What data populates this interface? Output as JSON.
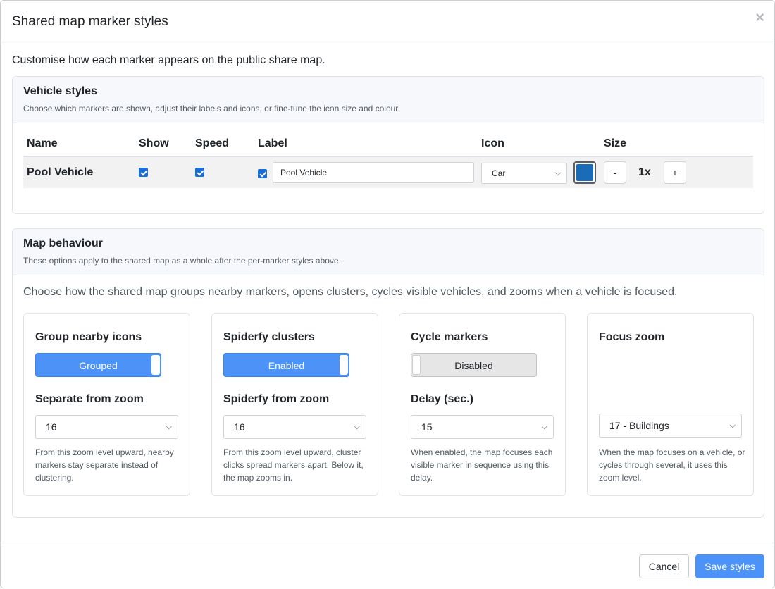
{
  "modal": {
    "title": "Shared map marker styles",
    "close_glyph": "×",
    "intro": "Customise how each marker appears on the public share map."
  },
  "vehicle_styles": {
    "title": "Vehicle styles",
    "subtitle": "Choose which markers are shown, adjust their labels and icons, or fine-tune the icon size and colour.",
    "columns": {
      "name": "Name",
      "show": "Show",
      "speed": "Speed",
      "label": "Label",
      "icon": "Icon",
      "size": "Size"
    },
    "rows": [
      {
        "name": "Pool Vehicle",
        "show": true,
        "speed": true,
        "label_enabled": true,
        "label_value": "Pool Vehicle",
        "icon_value": "Car",
        "color": "#1a6bb8",
        "size_minus": "-",
        "size_value": "1x",
        "size_plus": "+"
      }
    ]
  },
  "map_behaviour": {
    "title": "Map behaviour",
    "subtitle": "These options apply to the shared map as a whole after the per-marker styles above.",
    "description": "Choose how the shared map groups nearby markers, opens clusters, cycles visible vehicles, and zooms when a vehicle is focused.",
    "options": {
      "group": {
        "title": "Group nearby icons",
        "toggle_label": "Grouped",
        "toggle_on": true,
        "sub_title": "Separate from zoom",
        "select_value": "16",
        "help": "From this zoom level upward, nearby markers stay separate instead of clustering."
      },
      "spiderfy": {
        "title": "Spiderfy clusters",
        "toggle_label": "Enabled",
        "toggle_on": true,
        "sub_title": "Spiderfy from zoom",
        "select_value": "16",
        "help": "From this zoom level upward, cluster clicks spread markers apart. Below it, the map zooms in."
      },
      "cycle": {
        "title": "Cycle markers",
        "toggle_label": "Disabled",
        "toggle_on": false,
        "sub_title": "Delay (sec.)",
        "select_value": "15",
        "help": "When enabled, the map focuses each visible marker in sequence using this delay."
      },
      "focus": {
        "title": "Focus zoom",
        "select_value": "17 - Buildings",
        "help": "When the map focuses on a vehicle, or cycles through several, it uses this zoom level."
      }
    }
  },
  "footer": {
    "cancel_label": "Cancel",
    "save_label": "Save styles"
  },
  "colors": {
    "accent": "#4d93f7",
    "checkbox": "#1a6ed8"
  },
  "icons": {
    "close": "close-icon",
    "select_chevron": "chevron-down-icon",
    "checkbox_check": "checkmark-icon"
  }
}
